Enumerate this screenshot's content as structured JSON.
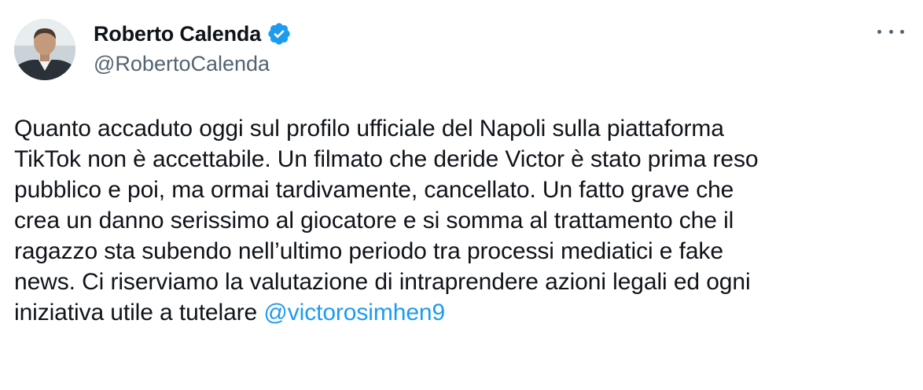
{
  "author": {
    "display_name": "Roberto Calenda",
    "handle": "@RobertoCalenda",
    "verified": true,
    "avatar_icon": "profile-photo",
    "verified_icon": "verified-badge-icon",
    "verified_color": "#1d9bf0"
  },
  "more_icon": "more-options-icon",
  "tweet": {
    "lines": [
      "Quanto accaduto oggi sul profilo ufficiale del Napoli sulla piattaforma",
      "TikTok non è accettabile. Un filmato che deride Victor è stato prima reso",
      "pubblico e poi, ma ormai tardivamente, cancellato. Un fatto grave che",
      "crea un danno serissimo al giocatore e si somma al trattamento che il",
      "ragazzo sta subendo nell’ultimo periodo tra processi mediatici e fake",
      "news. Ci riserviamo la valutazione di intraprendere azioni legali ed ogni",
      "iniziativa utile a tutelare "
    ],
    "mention": "@victorosimhen9",
    "mention_color": "#1d9bf0"
  }
}
